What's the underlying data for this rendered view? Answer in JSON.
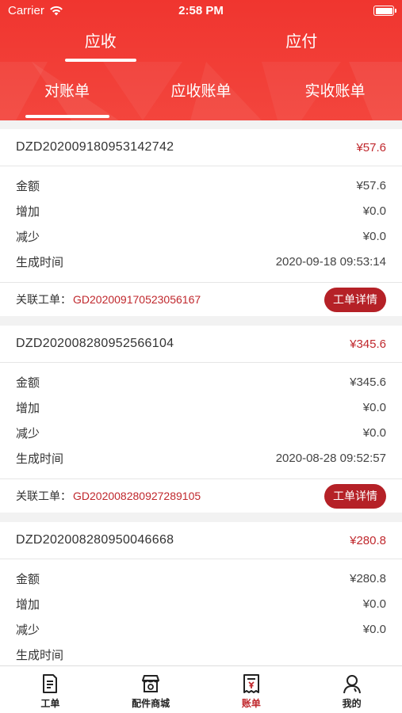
{
  "status_bar": {
    "carrier": "Carrier",
    "time": "2:58 PM"
  },
  "top_tabs": [
    {
      "label": "应收"
    },
    {
      "label": "应付"
    }
  ],
  "sub_tabs": [
    {
      "label": "对账单"
    },
    {
      "label": "应收账单"
    },
    {
      "label": "实收账单"
    }
  ],
  "row_labels": {
    "amount": "金额",
    "increase": "增加",
    "decrease": "减少",
    "created": "生成时间"
  },
  "related_label": "关联工单：",
  "detail_button": "工单详情",
  "bills": [
    {
      "id": "DZD202009180953142742",
      "total": "¥57.6",
      "amount": "¥57.6",
      "increase": "¥0.0",
      "decrease": "¥0.0",
      "created": "2020-09-18 09:53:14",
      "work_order": "GD202009170523056167"
    },
    {
      "id": "DZD202008280952566104",
      "total": "¥345.6",
      "amount": "¥345.6",
      "increase": "¥0.0",
      "decrease": "¥0.0",
      "created": "2020-08-28 09:52:57",
      "work_order": "GD202008280927289105"
    },
    {
      "id": "DZD202008280950046668",
      "total": "¥280.8",
      "amount": "¥280.8",
      "increase": "¥0.0",
      "decrease": "¥0.0",
      "created": "",
      "work_order": ""
    }
  ],
  "tabbar": [
    {
      "label": "工单",
      "icon": "work-order-icon"
    },
    {
      "label": "配件商城",
      "icon": "store-icon"
    },
    {
      "label": "账单",
      "icon": "bill-icon"
    },
    {
      "label": "我的",
      "icon": "profile-icon"
    }
  ],
  "colors": {
    "header_red": "#f0352f",
    "accent_red": "#c0282d",
    "button_red": "#b52127"
  }
}
